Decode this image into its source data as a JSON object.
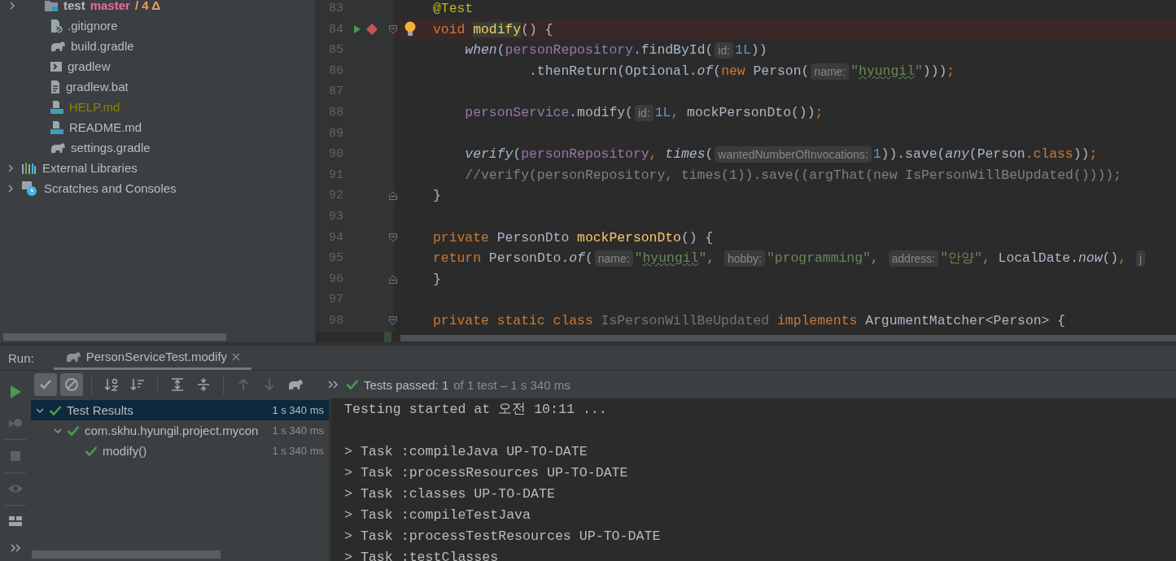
{
  "project_tree": {
    "items": [
      {
        "kind": "folder",
        "label": "test",
        "expanded": false,
        "branch": "master",
        "changes": "/ 4 Δ",
        "color": "#bbbbbb"
      },
      {
        "kind": "gitignore",
        "label": ".gitignore",
        "color": "#bbbbbb"
      },
      {
        "kind": "gradle",
        "label": "build.gradle",
        "color": "#bbbbbb"
      },
      {
        "kind": "shell",
        "label": "gradlew",
        "color": "#bbbbbb"
      },
      {
        "kind": "text",
        "label": "gradlew.bat",
        "color": "#bbbbbb"
      },
      {
        "kind": "markdown",
        "label": "HELP.md",
        "color": "#848504"
      },
      {
        "kind": "markdown",
        "label": "README.md",
        "color": "#bbbbbb"
      },
      {
        "kind": "gradle",
        "label": "settings.gradle",
        "color": "#bbbbbb"
      }
    ],
    "roots": [
      {
        "kind": "libraries",
        "label": "External Libraries",
        "expanded": false
      },
      {
        "kind": "scratches",
        "label": "Scratches and Consoles",
        "expanded": false
      }
    ]
  },
  "editor": {
    "lines": [
      {
        "number": "83",
        "current": false,
        "tokens": [
          {
            "kind": "annot",
            "text": "@Test"
          }
        ]
      },
      {
        "number": "84",
        "current": true,
        "markers": [
          {
            "kind": "run"
          },
          {
            "kind": "breakpoint"
          },
          {
            "kind": "bulb"
          }
        ],
        "fold": {
          "kind": "open"
        },
        "tokens": [
          {
            "kind": "kw",
            "text": "void "
          },
          {
            "kind": "decl-hl",
            "text": "modify"
          },
          {
            "kind": "plain",
            "text": "() {"
          }
        ]
      },
      {
        "number": "85",
        "current": false,
        "tokens": [
          {
            "kind": "ital",
            "text": "    when"
          },
          {
            "kind": "plain",
            "text": "("
          },
          {
            "kind": "field",
            "text": "personRepository"
          },
          {
            "kind": "plain",
            "text": ".findById("
          },
          {
            "kind": "hint",
            "text": "id:"
          },
          {
            "kind": "num",
            "text": "1L"
          },
          {
            "kind": "plain",
            "text": "))"
          }
        ]
      },
      {
        "number": "86",
        "current": false,
        "tokens": [
          {
            "kind": "plain",
            "text": "            .thenReturn(Optional."
          },
          {
            "kind": "ital",
            "text": "of"
          },
          {
            "kind": "plain",
            "text": "("
          },
          {
            "kind": "kw",
            "text": "new "
          },
          {
            "kind": "plain",
            "text": "Person("
          },
          {
            "kind": "hint",
            "text": "name:"
          },
          {
            "kind": "str",
            "text": "\""
          },
          {
            "kind": "str-typo",
            "text": "hyungil"
          },
          {
            "kind": "str",
            "text": "\""
          },
          {
            "kind": "plain",
            "text": ")))"
          },
          {
            "kind": "kw",
            "text": ";"
          }
        ]
      },
      {
        "number": "87",
        "current": false
      },
      {
        "number": "88",
        "current": false,
        "tokens": [
          {
            "kind": "field",
            "text": "    personService"
          },
          {
            "kind": "plain",
            "text": ".modify("
          },
          {
            "kind": "hint",
            "text": "id:"
          },
          {
            "kind": "num",
            "text": "1L"
          },
          {
            "kind": "kw",
            "text": ", "
          },
          {
            "kind": "plain",
            "text": "mockPersonDto())"
          },
          {
            "kind": "kw",
            "text": ";"
          }
        ]
      },
      {
        "number": "89",
        "current": false
      },
      {
        "number": "90",
        "current": false,
        "tokens": [
          {
            "kind": "ital",
            "text": "    verify"
          },
          {
            "kind": "plain",
            "text": "("
          },
          {
            "kind": "field",
            "text": "personRepository"
          },
          {
            "kind": "kw",
            "text": ", "
          },
          {
            "kind": "ital",
            "text": "times"
          },
          {
            "kind": "plain",
            "text": "("
          },
          {
            "kind": "hint",
            "text": "wantedNumberOfInvocations:"
          },
          {
            "kind": "num",
            "text": "1"
          },
          {
            "kind": "plain",
            "text": ")).save("
          },
          {
            "kind": "ital",
            "text": "any"
          },
          {
            "kind": "plain",
            "text": "(Person"
          },
          {
            "kind": "kw",
            "text": ".class"
          },
          {
            "kind": "plain",
            "text": "))"
          },
          {
            "kind": "kw",
            "text": ";"
          }
        ]
      },
      {
        "number": "91",
        "current": false,
        "tokens": [
          {
            "kind": "comment",
            "text": "    //verify(personRepository, times(1)).save((argThat(new IsPersonWillBeUpdated())));"
          }
        ]
      },
      {
        "number": "92",
        "current": false,
        "fold": {
          "kind": "close"
        },
        "tokens": [
          {
            "kind": "plain",
            "text": "}"
          }
        ]
      },
      {
        "number": "93",
        "current": false
      },
      {
        "number": "94",
        "current": false,
        "fold": {
          "kind": "open"
        },
        "tokens": [
          {
            "kind": "kw",
            "text": "private "
          },
          {
            "kind": "plain",
            "text": "PersonDto "
          },
          {
            "kind": "decl",
            "text": "mockPersonDto"
          },
          {
            "kind": "plain",
            "text": "() {"
          }
        ]
      },
      {
        "number": "95",
        "current": false,
        "tokens": [
          {
            "kind": "kw",
            "text": "return "
          },
          {
            "kind": "plain",
            "text": "PersonDto."
          },
          {
            "kind": "ital",
            "text": "of"
          },
          {
            "kind": "plain",
            "text": "("
          },
          {
            "kind": "hint",
            "text": "name:"
          },
          {
            "kind": "str",
            "text": "\""
          },
          {
            "kind": "str-typo",
            "text": "hyungil"
          },
          {
            "kind": "str",
            "text": "\""
          },
          {
            "kind": "kw",
            "text": ", "
          },
          {
            "kind": "hint",
            "text": "hobby:"
          },
          {
            "kind": "str",
            "text": "\"programming\""
          },
          {
            "kind": "kw",
            "text": ", "
          },
          {
            "kind": "hint",
            "text": "address:"
          },
          {
            "kind": "str",
            "text": "\"안양\""
          },
          {
            "kind": "kw",
            "text": ", "
          },
          {
            "kind": "plain",
            "text": "LocalDate."
          },
          {
            "kind": "ital",
            "text": "now"
          },
          {
            "kind": "plain",
            "text": "()"
          },
          {
            "kind": "kw",
            "text": ", "
          },
          {
            "kind": "hint",
            "text": "j"
          }
        ]
      },
      {
        "number": "96",
        "current": false,
        "fold": {
          "kind": "close"
        },
        "tokens": [
          {
            "kind": "plain",
            "text": "}"
          }
        ]
      },
      {
        "number": "97",
        "current": false
      },
      {
        "number": "98",
        "current": false,
        "fold": {
          "kind": "open"
        },
        "tokens": [
          {
            "kind": "kw",
            "text": "private static class "
          },
          {
            "kind": "unused",
            "text": "IsPersonWillBeUpdated "
          },
          {
            "kind": "kw",
            "text": "implements "
          },
          {
            "kind": "plain",
            "text": "ArgumentMatcher<Person> {"
          }
        ]
      }
    ]
  },
  "run_panel": {
    "label": "Run:",
    "tabs": [
      {
        "title": "PersonServiceTest.modify",
        "selected": true
      }
    ],
    "side_tools": [
      {
        "kind": "run",
        "disabled": false
      },
      {
        "kind": "rerun-failed",
        "disabled": true
      },
      {
        "kind": "stop",
        "disabled": true
      },
      {
        "kind": "view",
        "disabled": true
      },
      {
        "kind": "layout",
        "disabled": false
      },
      {
        "kind": "more",
        "disabled": false
      }
    ],
    "toolbar": [
      {
        "kind": "show-passed",
        "selected": true,
        "disabled": false
      },
      {
        "kind": "show-ignored",
        "selected": true,
        "disabled": false
      },
      {
        "kind": "sort-alpha",
        "selected": false,
        "disabled": false
      },
      {
        "kind": "sort-duration",
        "selected": false,
        "disabled": false
      },
      {
        "kind": "expand-all",
        "selected": false,
        "disabled": false
      },
      {
        "kind": "collapse-all",
        "selected": false,
        "disabled": false
      },
      {
        "kind": "previous",
        "selected": false,
        "disabled": true
      },
      {
        "kind": "next",
        "selected": false,
        "disabled": true
      },
      {
        "kind": "gradle",
        "selected": false,
        "disabled": false
      }
    ],
    "status": {
      "title": "Tests passed: 1",
      "detail": "of 1 test – 1 s 340 ms"
    },
    "results": [
      {
        "label": "Test Results",
        "time": "1 s 340 ms",
        "selected": true,
        "expanded": true,
        "children": [
          {
            "label": "com.skhu.hyungil.project.mycon",
            "time": "1 s 340 ms",
            "selected": false,
            "expanded": true,
            "children": [
              {
                "label": "modify()",
                "time": "1 s 340 ms",
                "selected": false
              }
            ]
          }
        ]
      }
    ],
    "console": {
      "header": "Testing started at 오전 10:11 ...",
      "tasks": [
        "> Task :compileJava UP-TO-DATE",
        "> Task :processResources UP-TO-DATE",
        "> Task :classes UP-TO-DATE",
        "> Task :compileTestJava",
        "> Task :processTestResources UP-TO-DATE",
        "> Task :testClasses"
      ]
    }
  }
}
